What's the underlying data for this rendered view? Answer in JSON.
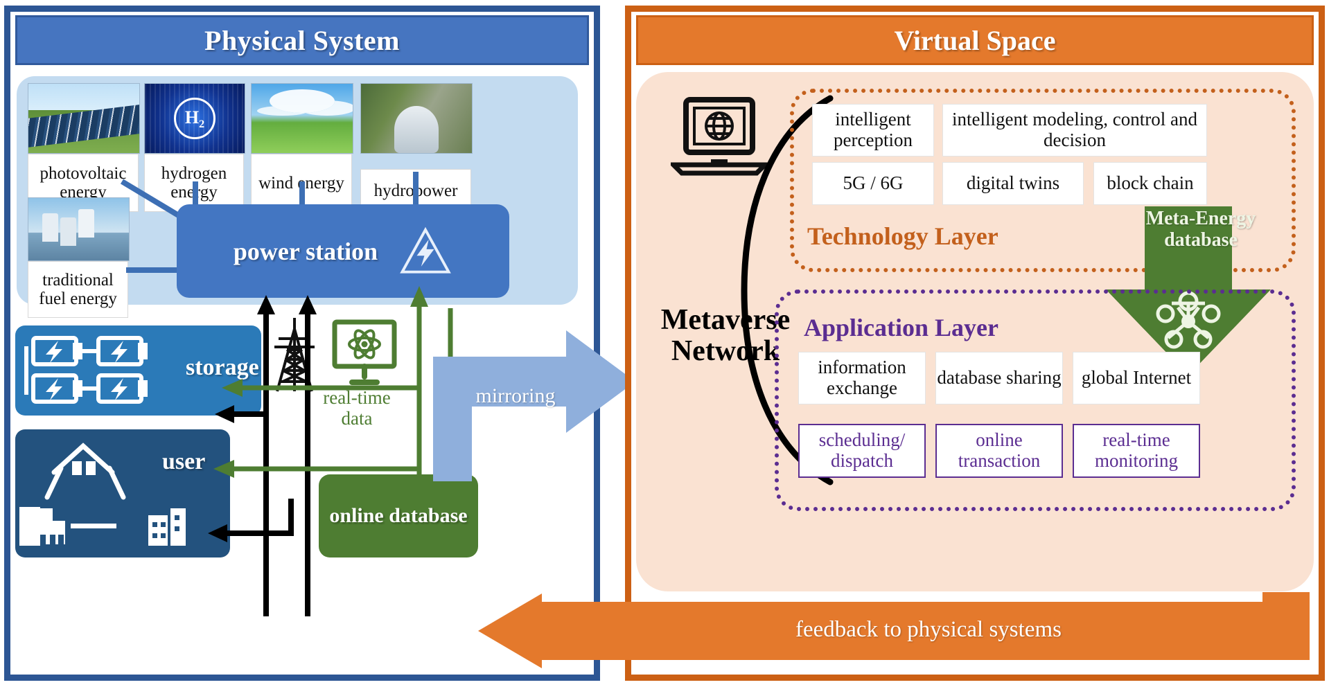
{
  "left_panel": {
    "title": "Physical System",
    "sources": [
      {
        "label": "photovoltaic energy",
        "icon": "solar-panel-photo"
      },
      {
        "label": "hydrogen energy",
        "icon": "hydrogen-h2-photo"
      },
      {
        "label": "wind energy",
        "icon": "wind-turbine-photo"
      },
      {
        "label": "hydropower",
        "icon": "hydro-dam-photo"
      },
      {
        "label": "traditional fuel energy",
        "icon": "fuel-plant-photo"
      }
    ],
    "power_station": {
      "label": "power station",
      "icon": "high-voltage-icon"
    },
    "storage": {
      "label": "storage",
      "icon": "battery-array-icon"
    },
    "user": {
      "label": "user",
      "icon": "house-factory-buildings-icon"
    },
    "online_database": {
      "label": "online database"
    },
    "real_time_data": "real-time data",
    "pylon_icon": "transmission-tower-icon",
    "monitor_icon": "atom-monitor-icon"
  },
  "mirroring": {
    "label": "mirroring",
    "color": "#8fafdc"
  },
  "metaverse": {
    "label": "Metaverse Network"
  },
  "right_panel": {
    "title": "Virtual Space",
    "laptop_icon": "laptop-globe-icon",
    "technology_layer": {
      "title": "Technology Layer",
      "color": "#c3601c",
      "items": [
        "intelligent perception",
        "intelligent modeling, control and decision",
        "5G / 6G",
        "digital twins",
        "block chain"
      ]
    },
    "application_layer": {
      "title": "Application Layer",
      "color": "#5b2d91",
      "items": [
        "information exchange",
        "database sharing",
        "global Internet"
      ],
      "highlighted_items": [
        "scheduling/ dispatch",
        "online transaction",
        "real-time monitoring"
      ]
    },
    "meta_energy": {
      "label": "Meta-Energy database",
      "icon": "network-nodes-icon",
      "color": "#4e7d32"
    }
  },
  "feedback": {
    "label": "feedback to physical systems",
    "color": "#e4792c"
  },
  "colors": {
    "physical_border": "#2d5694",
    "physical_header": "#4675c0",
    "virtual_border": "#cc6014",
    "virtual_header": "#e4792c",
    "virtual_body": "#fae2d2",
    "green": "#4e7d32",
    "purple": "#5b2d91"
  }
}
